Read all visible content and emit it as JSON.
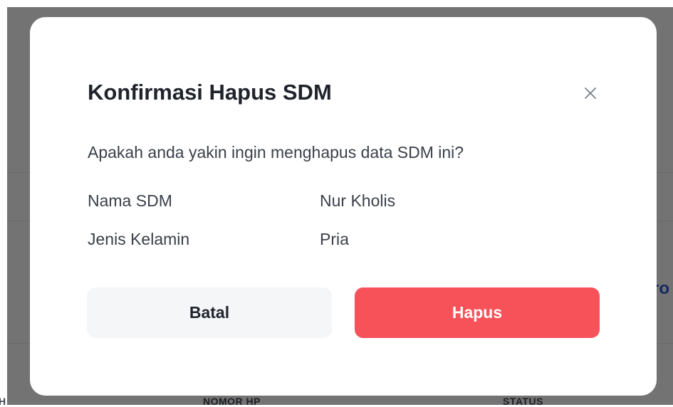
{
  "background": {
    "peek_text": "ro",
    "table_headers": [
      {
        "label": "H"
      },
      {
        "label": "NOMOR HP"
      },
      {
        "label": "STATUS"
      }
    ]
  },
  "modal": {
    "title": "Konfirmasi Hapus SDM",
    "close_icon": "close-icon",
    "message": "Apakah anda yakin ingin menghapus data SDM ini?",
    "details": [
      {
        "label": "Nama SDM",
        "value": "Nur Kholis"
      },
      {
        "label": "Jenis Kelamin",
        "value": "Pria"
      }
    ],
    "cancel_label": "Batal",
    "confirm_label": "Hapus"
  },
  "colors": {
    "danger": "#f7515a",
    "overlay": "rgba(0,0,0,0.55)",
    "cancel_bg": "#f5f6f8"
  }
}
